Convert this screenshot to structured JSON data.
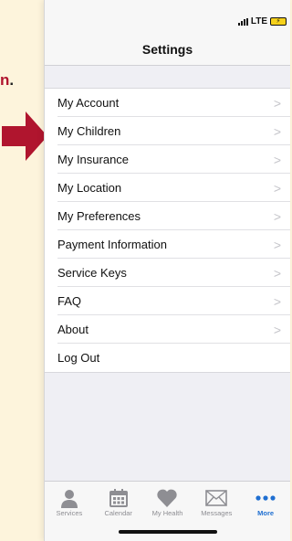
{
  "background_text": {
    "label": "n",
    "period": "."
  },
  "status": {
    "carrier": "LTE",
    "battery": "⚡"
  },
  "header": {
    "title": "Settings"
  },
  "settings": {
    "items": [
      {
        "label": "My Account"
      },
      {
        "label": "My Children"
      },
      {
        "label": "My Insurance"
      },
      {
        "label": "My Location"
      },
      {
        "label": "My Preferences"
      },
      {
        "label": "Payment Information"
      },
      {
        "label": "Service Keys"
      },
      {
        "label": "FAQ"
      },
      {
        "label": "About"
      },
      {
        "label": "Log Out"
      }
    ]
  },
  "tabs": [
    {
      "label": "Services",
      "icon": "person-icon"
    },
    {
      "label": "Calendar",
      "icon": "calendar-icon"
    },
    {
      "label": "My Health",
      "icon": "heart-icon"
    },
    {
      "label": "Messages",
      "icon": "envelope-icon"
    },
    {
      "label": "More",
      "icon": "more-dots-icon",
      "active": true
    }
  ],
  "colors": {
    "accent": "#1f6fd1",
    "arrow": "#b0152e",
    "background": "#fdf4dc"
  }
}
